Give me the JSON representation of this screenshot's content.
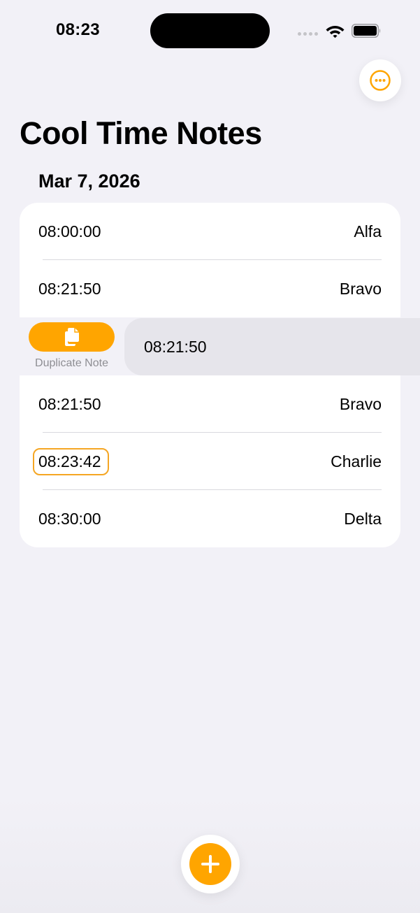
{
  "status_bar": {
    "time": "08:23"
  },
  "header": {
    "title": "Cool Time Notes",
    "more_icon": "ellipsis-circle-icon"
  },
  "section": {
    "date": "Mar 7, 2026"
  },
  "notes_top": [
    {
      "time": "08:00:00",
      "name": "Alfa"
    },
    {
      "time": "08:21:50",
      "name": "Bravo"
    }
  ],
  "swiped_note": {
    "time": "08:21:50",
    "action_label": "Duplicate Note",
    "action_icon": "doc-on-doc-icon"
  },
  "notes_bottom": [
    {
      "time": "08:21:50",
      "name": "Bravo"
    },
    {
      "time": "08:23:42",
      "name": "Charlie"
    },
    {
      "time": "08:30:00",
      "name": "Delta"
    }
  ],
  "add_button": {
    "icon": "plus-icon"
  },
  "colors": {
    "accent": "#ffa500",
    "background": "#f2f1f7",
    "card": "#ffffff",
    "secondary_text": "#8e8e93"
  }
}
